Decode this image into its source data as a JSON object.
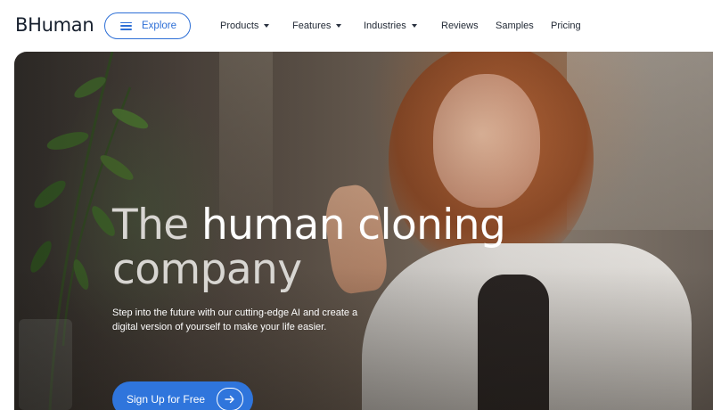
{
  "brand": {
    "logo_text": "BHuman"
  },
  "nav": {
    "explore_label": "Explore",
    "items": [
      {
        "label": "Products",
        "has_dropdown": true
      },
      {
        "label": "Features",
        "has_dropdown": true
      },
      {
        "label": "Industries",
        "has_dropdown": true
      },
      {
        "label": "Reviews",
        "has_dropdown": false
      },
      {
        "label": "Samples",
        "has_dropdown": false
      },
      {
        "label": "Pricing",
        "has_dropdown": false
      }
    ]
  },
  "hero": {
    "headline_light_1": "The ",
    "headline_bright": "human cloning",
    "headline_light_2": "company",
    "subtitle": "Step into the future with our cutting-edge AI and create a digital version of yourself to make your life easier.",
    "cta_label": "Sign Up for Free",
    "cta_icon": "arrow-right-icon"
  },
  "colors": {
    "accent": "#2f75dc",
    "text_dark": "#1c2433",
    "hero_headline": "#ffffff"
  }
}
